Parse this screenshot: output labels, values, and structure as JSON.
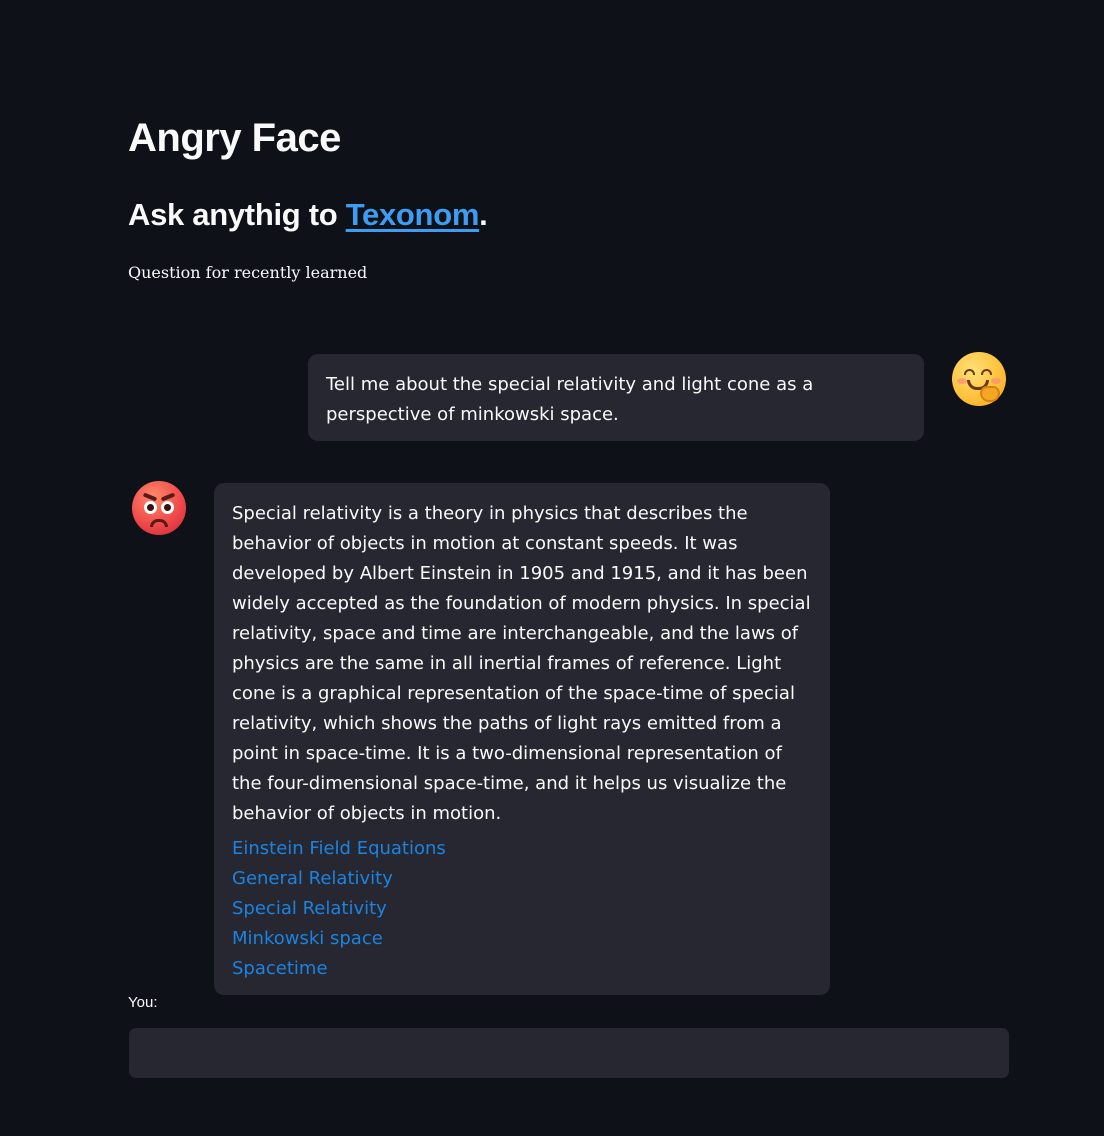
{
  "header": {
    "title": "Angry Face",
    "subtitle_prefix": "Ask anythig to ",
    "subtitle_link": "Texonom",
    "subtitle_suffix": ".",
    "caption": "Question for recently learned"
  },
  "chat": {
    "user_message": "Tell me about the special relativity and light cone as a perspective of minkowski space.",
    "user_avatar_icon": "smiling-face-with-hand-emoji",
    "bot_avatar_icon": "angry-face-emoji",
    "bot_message": "Special relativity is a theory in physics that describes the behavior of objects in motion at constant speeds. It was developed by Albert Einstein in 1905 and 1915, and it has been widely accepted as the foundation of modern physics. In special relativity, space and time are interchangeable, and the laws of physics are the same in all inertial frames of reference. Light cone is a graphical representation of the space-time of special relativity, which shows the paths of light rays emitted from a point in space-time. It is a two-dimensional representation of the four-dimensional space-time, and it helps us visualize the behavior of objects in motion.",
    "links": [
      "Einstein Field Equations",
      "General Relativity",
      "Special Relativity",
      "Minkowski space",
      "Spacetime"
    ]
  },
  "input": {
    "label": "You:",
    "value": ""
  },
  "colors": {
    "background": "#0e1117",
    "bubble": "#262730",
    "link": "#1c83e1",
    "subtitle_link": "#3d9df3"
  }
}
